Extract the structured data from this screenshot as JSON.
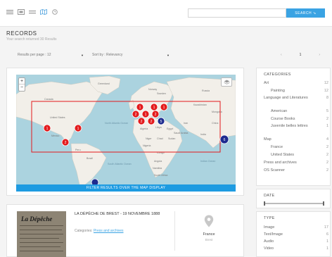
{
  "search": {
    "placeholder": "",
    "button_label": "SEARCH ⇘"
  },
  "header": {
    "view_icons": [
      "list-view-icon",
      "gallery-view-icon",
      "compact-view-icon",
      "map-view-icon",
      "timeline-view-icon"
    ]
  },
  "page": {
    "title": "RECORDS",
    "results_text": "Your search returned 30 Results"
  },
  "controls": {
    "per_page": "Results per page : 12",
    "sort": "Sort by : Relevancy",
    "pager": {
      "prev": "‹",
      "current": "1",
      "next": "›"
    }
  },
  "map": {
    "zoom_in": "+",
    "zoom_out": "−",
    "filter_label": "FILTER RESULTS OVER THE MAP DISPLAY",
    "clusters": [
      {
        "label": "1",
        "color": "#e31a1c"
      },
      {
        "label": "1",
        "color": "#e31a1c"
      },
      {
        "label": "2",
        "color": "#e31a1c"
      },
      {
        "label": "1",
        "color": "#e31a1c"
      },
      {
        "label": "1",
        "color": "#e31a1c"
      },
      {
        "label": "1",
        "color": "#e31a1c"
      },
      {
        "label": "2",
        "color": "#e31a1c"
      },
      {
        "label": "1",
        "color": "#e31a1c"
      },
      {
        "label": "2",
        "color": "#e31a1c"
      },
      {
        "label": "2",
        "color": "#e31a1c"
      },
      {
        "label": "2",
        "color": "#e31a1c"
      },
      {
        "label": "5",
        "color": "#1d2b8f"
      },
      {
        "label": "6",
        "color": "#1d2b8f"
      }
    ],
    "labels": [
      "Canada",
      "United States",
      "Mexico",
      "Brazil",
      "South Atlantic Ocean",
      "North Atlantic Ocean",
      "Algeria",
      "Libya",
      "Egypt",
      "Niger",
      "Chad",
      "Sudan",
      "Nigeria",
      "Congo",
      "Angola",
      "Namibia",
      "South Africa",
      "Kazakhstan",
      "Mongolia",
      "China",
      "India",
      "Indian Ocean",
      "Iran",
      "Saudi Arabia",
      "Greenland",
      "Norway",
      "Sweden",
      "Russia",
      "Peru"
    ]
  },
  "result": {
    "thumb_title": "La Dépêche",
    "title": "LA DÉPÊCHE DE BREST - 19 NOVEMBRE 1888",
    "categories_label": "Categories:",
    "category_link": "Press and archives",
    "country": "France",
    "city": "Brest"
  },
  "sidebar": {
    "categories_title": "CATEGORIES",
    "categories": [
      {
        "label": "Art",
        "count": "12",
        "sub": false
      },
      {
        "label": "Painting",
        "count": "12",
        "sub": true
      },
      {
        "label": "Language and Literatures",
        "count": "8",
        "sub": false
      },
      {
        "label": "American",
        "count": "5",
        "sub": true
      },
      {
        "label": "Course Books",
        "count": "2",
        "sub": true
      },
      {
        "label": "Juvenile belles lettres",
        "count": "1",
        "sub": true
      },
      {
        "label": "Map",
        "count": "4",
        "sub": false
      },
      {
        "label": "France",
        "count": "2",
        "sub": true
      },
      {
        "label": "United States",
        "count": "2",
        "sub": true
      },
      {
        "label": "Press and archives",
        "count": "2",
        "sub": false
      },
      {
        "label": "OS Scanner",
        "count": "2",
        "sub": false
      }
    ],
    "date_title": "DATE",
    "type_title": "TYPE",
    "types": [
      {
        "label": "Image",
        "count": "17"
      },
      {
        "label": "Text/Image",
        "count": "6"
      },
      {
        "label": "Audio",
        "count": "1"
      },
      {
        "label": "Video",
        "count": "1"
      }
    ]
  },
  "colors": {
    "accent": "#3aa3e3",
    "filter_bar": "#1e9be1",
    "cluster_red": "#e31a1c",
    "cluster_blue": "#1d2b8f",
    "selection_rect": "#e31a1c",
    "ocean": "#abd3df",
    "land": "#f2efe9"
  }
}
